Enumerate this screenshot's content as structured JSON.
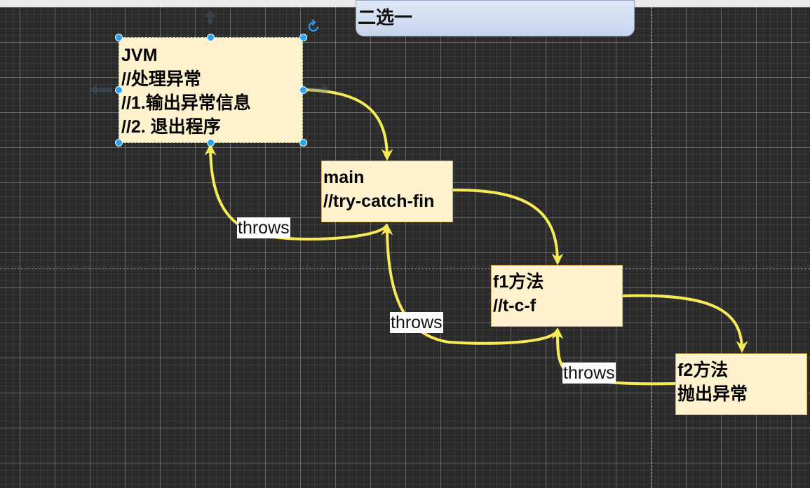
{
  "canvas": {
    "background": "#2b2b2b",
    "edge_color": "#f7ea57",
    "node_fill": "#fff2cc",
    "node_stroke": "#d6b656",
    "selection_color": "#29a4f2"
  },
  "header_box": {
    "text": "二选一"
  },
  "nodes": {
    "jvm": {
      "lines": [
        "JVM",
        "//处理异常",
        "//1.输出异常信息",
        "//2. 退出程序"
      ]
    },
    "main": {
      "lines": [
        "main",
        "//try-catch-fin"
      ]
    },
    "f1": {
      "lines": [
        "f1方法",
        "//t-c-f"
      ]
    },
    "f2": {
      "lines": [
        "f2方法",
        "抛出异常"
      ]
    }
  },
  "edge_labels": [
    "throws",
    "throws",
    "throws"
  ]
}
